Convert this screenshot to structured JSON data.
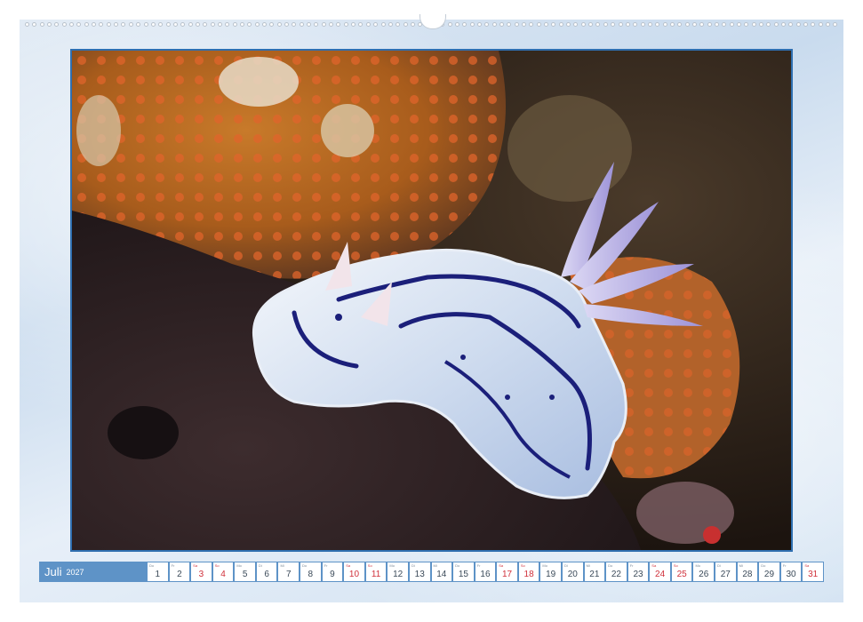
{
  "calendar": {
    "month": "Juli",
    "year": "2027",
    "days": [
      {
        "n": "1",
        "wd": "Do",
        "weekend": false
      },
      {
        "n": "2",
        "wd": "Fr",
        "weekend": false
      },
      {
        "n": "3",
        "wd": "Sa",
        "weekend": true
      },
      {
        "n": "4",
        "wd": "So",
        "weekend": true
      },
      {
        "n": "5",
        "wd": "Mo",
        "weekend": false
      },
      {
        "n": "6",
        "wd": "Di",
        "weekend": false
      },
      {
        "n": "7",
        "wd": "Mi",
        "weekend": false
      },
      {
        "n": "8",
        "wd": "Do",
        "weekend": false
      },
      {
        "n": "9",
        "wd": "Fr",
        "weekend": false
      },
      {
        "n": "10",
        "wd": "Sa",
        "weekend": true
      },
      {
        "n": "11",
        "wd": "So",
        "weekend": true
      },
      {
        "n": "12",
        "wd": "Mo",
        "weekend": false
      },
      {
        "n": "13",
        "wd": "Di",
        "weekend": false
      },
      {
        "n": "14",
        "wd": "Mi",
        "weekend": false
      },
      {
        "n": "15",
        "wd": "Do",
        "weekend": false
      },
      {
        "n": "16",
        "wd": "Fr",
        "weekend": false
      },
      {
        "n": "17",
        "wd": "Sa",
        "weekend": true
      },
      {
        "n": "18",
        "wd": "So",
        "weekend": true
      },
      {
        "n": "19",
        "wd": "Mo",
        "weekend": false
      },
      {
        "n": "20",
        "wd": "Di",
        "weekend": false
      },
      {
        "n": "21",
        "wd": "Mi",
        "weekend": false
      },
      {
        "n": "22",
        "wd": "Do",
        "weekend": false
      },
      {
        "n": "23",
        "wd": "Fr",
        "weekend": false
      },
      {
        "n": "24",
        "wd": "Sa",
        "weekend": true
      },
      {
        "n": "25",
        "wd": "So",
        "weekend": true
      },
      {
        "n": "26",
        "wd": "Mo",
        "weekend": false
      },
      {
        "n": "27",
        "wd": "Di",
        "weekend": false
      },
      {
        "n": "28",
        "wd": "Mi",
        "weekend": false
      },
      {
        "n": "29",
        "wd": "Do",
        "weekend": false
      },
      {
        "n": "30",
        "wd": "Fr",
        "weekend": false
      },
      {
        "n": "31",
        "wd": "Sa",
        "weekend": true
      }
    ]
  },
  "colors": {
    "bar": "#5e93c7",
    "weekend": "#d0303a",
    "frame": "#2f6fb0"
  },
  "photo": {
    "subject": "nudibranch-on-coral"
  }
}
